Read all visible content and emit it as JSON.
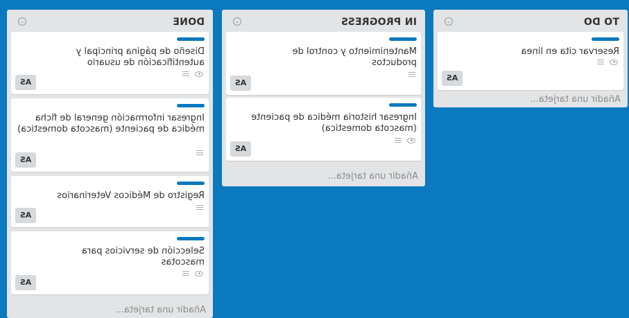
{
  "colors": {
    "board": "#0a79bf",
    "list": "#e2e4e6",
    "label": "#0a79bf"
  },
  "lists": [
    {
      "title": "TO DO",
      "menu_icon": "chevron-down-icon",
      "add_card": "Añadir una tarjeta...",
      "cards": [
        {
          "title": "Reservar cita en linea",
          "avatar": "AS",
          "badges": [
            "description-icon",
            "watch-icon"
          ]
        }
      ]
    },
    {
      "title": "IN PROGRESS",
      "menu_icon": "chevron-down-icon",
      "add_card": "Añadir una tarjeta...",
      "cards": [
        {
          "title": "Mantenimiento y control de productos",
          "avatar": "AS",
          "badges": [
            "description-icon"
          ]
        },
        {
          "title": "Ingresar historia médica de paciente (mascota domestica)",
          "avatar": "AS",
          "badges": [
            "description-icon",
            "watch-icon"
          ]
        }
      ]
    },
    {
      "title": "DONE",
      "menu_icon": "chevron-down-icon",
      "add_card": "Añadir una tarjeta...",
      "cards": [
        {
          "title": "Diseño de página principal y autentificación de usuario",
          "avatar": "AS",
          "badges": [
            "description-icon",
            "watch-icon"
          ]
        },
        {
          "title": "Ingresar información general de ficha médica de paciente (mascota domestica)",
          "avatar": "AS",
          "badges": [
            "description-icon"
          ]
        },
        {
          "title": "Registro de Médicos Veterinarios",
          "avatar": "AS",
          "badges": [
            "description-icon"
          ]
        },
        {
          "title": "Selección de servicios para mascotas",
          "avatar": "AS",
          "badges": [
            "description-icon",
            "watch-icon"
          ]
        }
      ]
    }
  ]
}
